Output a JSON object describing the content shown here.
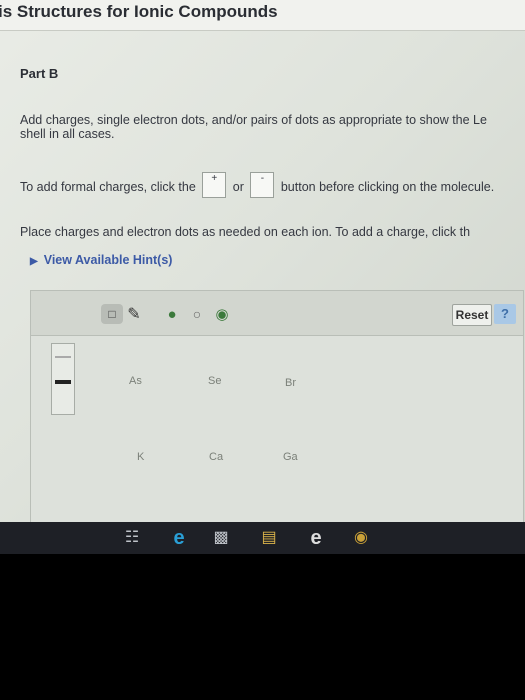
{
  "header": {
    "title": "is Structures for Ionic Compounds"
  },
  "part": {
    "label": "Part B"
  },
  "instructions": {
    "line1": "Add charges, single electron dots, and/or pairs of dots as appropriate to show the Le",
    "line2": "shell in all cases.",
    "formal_a": "To add formal charges, click the",
    "plus_label": "+",
    "or_text": "or",
    "minus_label": "-",
    "formal_b": "button before clicking on the molecule.",
    "line4": "Place charges and electron dots as needed on each ion. To add a charge, click th"
  },
  "hint": {
    "label": "View Available Hint(s)"
  },
  "editor": {
    "reset_label": "Reset",
    "help_label": "?",
    "atoms": [
      "As",
      "Se",
      "Br",
      "K",
      "Ca",
      "Ga"
    ]
  },
  "icons": {
    "toolbar": [
      "select-icon",
      "pencil-icon",
      "add-dot-icon",
      "erase-icon",
      "add-pair-icon"
    ],
    "taskbar": [
      "task-view-icon",
      "edge-icon",
      "explorer-icon",
      "store-icon",
      "ie-icon",
      "chrome-icon"
    ]
  }
}
